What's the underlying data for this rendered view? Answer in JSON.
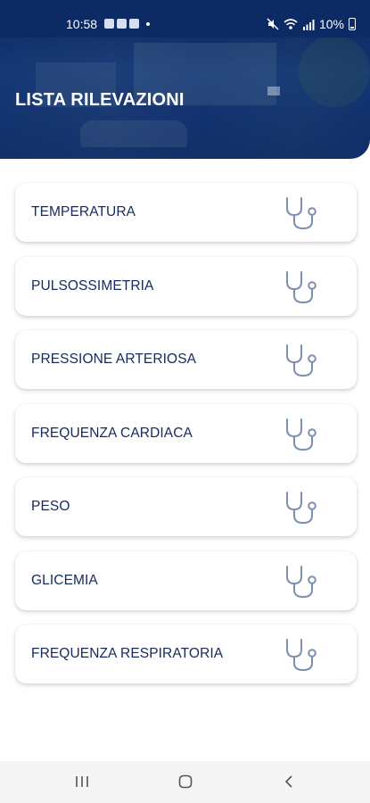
{
  "status_bar": {
    "time": "10:58",
    "battery": "10%"
  },
  "header": {
    "title": "LISTA RILEVAZIONI"
  },
  "list": {
    "items": [
      {
        "label": "TEMPERATURA",
        "icon": "stethoscope-icon"
      },
      {
        "label": "PULSOSSIMETRIA",
        "icon": "stethoscope-icon"
      },
      {
        "label": "PRESSIONE ARTERIOSA",
        "icon": "stethoscope-icon"
      },
      {
        "label": "FREQUENZA CARDIACA",
        "icon": "stethoscope-icon"
      },
      {
        "label": "PESO",
        "icon": "stethoscope-icon"
      },
      {
        "label": "GLICEMIA",
        "icon": "stethoscope-icon"
      },
      {
        "label": "FREQUENZA RESPIRATORIA",
        "icon": "stethoscope-icon"
      }
    ]
  },
  "colors": {
    "header_blue": "#0c2a63",
    "label_navy": "#14295c",
    "icon_gray_blue": "#7b8fb0"
  }
}
